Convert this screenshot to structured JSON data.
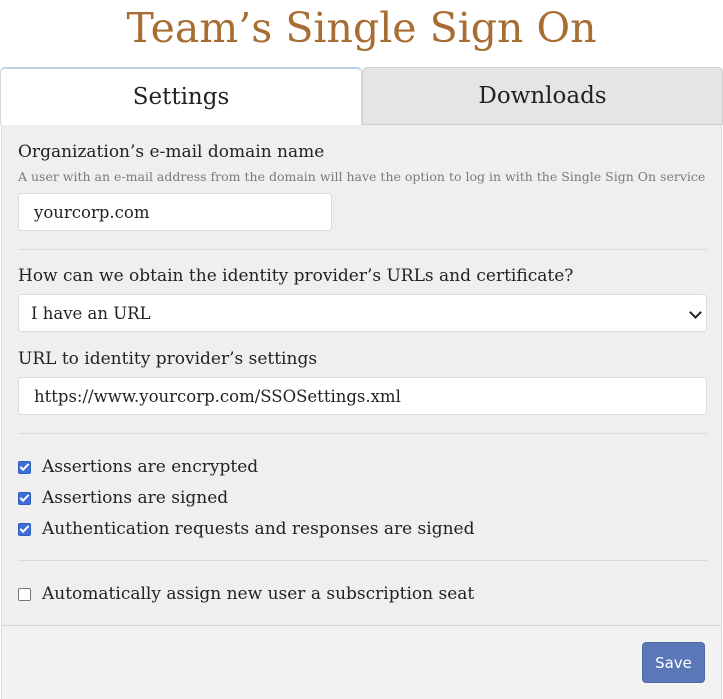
{
  "page": {
    "title": "Team’s Single Sign On"
  },
  "tabs": [
    {
      "label": "Settings",
      "active": true
    },
    {
      "label": "Downloads",
      "active": false
    }
  ],
  "form": {
    "domain": {
      "label": "Organization’s e-mail domain name",
      "hint": "A user with an e-mail address from the domain will have the option to log in with the Single Sign On service",
      "value": "yourcorp.com"
    },
    "idp_method": {
      "label": "How can we obtain the identity provider’s URLs and certificate?",
      "selected": "I have an URL"
    },
    "idp_url": {
      "label": "URL to identity provider’s settings",
      "value": "https://www.yourcorp.com/SSOSettings.xml"
    },
    "checkboxes": [
      {
        "label": "Assertions are encrypted",
        "checked": true
      },
      {
        "label": "Assertions are signed",
        "checked": true
      },
      {
        "label": "Authentication requests and responses are signed",
        "checked": true
      }
    ],
    "auto_assign": {
      "label": "Automatically assign new user a subscription seat",
      "checked": false
    }
  },
  "footer": {
    "save_label": "Save"
  },
  "colors": {
    "title": "#a86d32",
    "accent": "#5a78b8",
    "checkbox": "#3b6fd6",
    "panel_bg": "#efefef"
  }
}
